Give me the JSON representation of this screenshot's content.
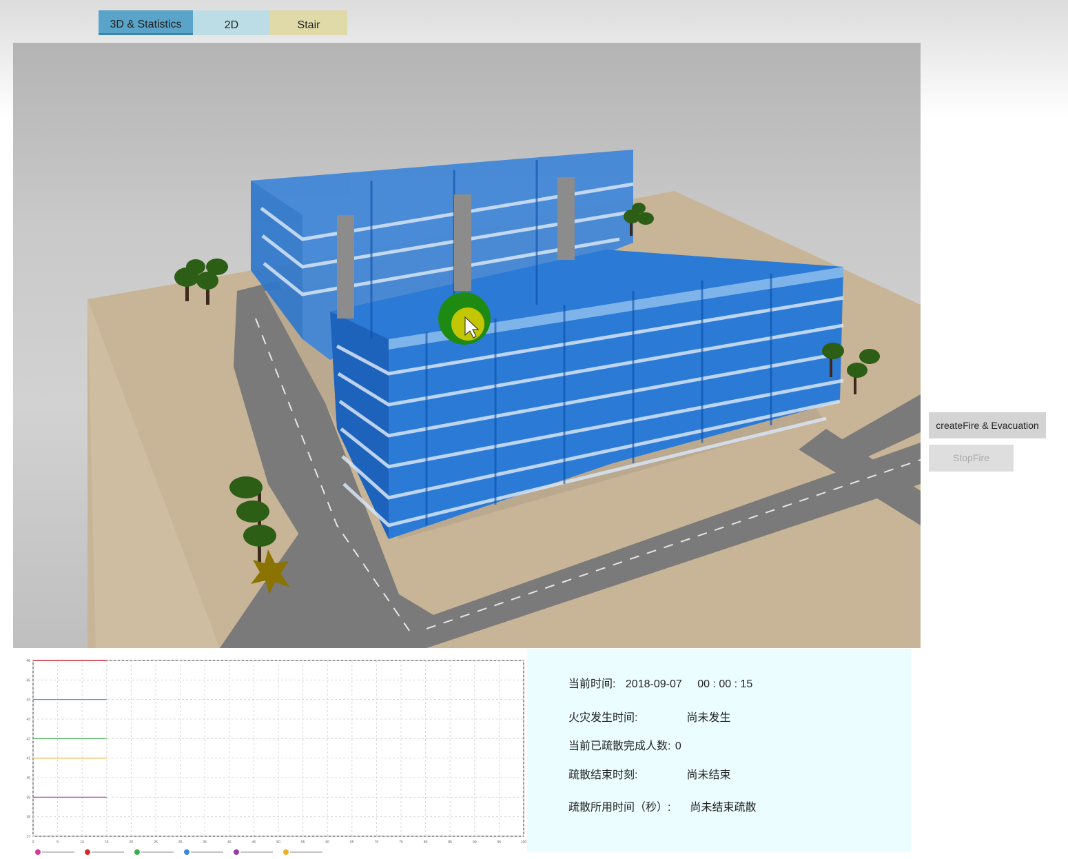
{
  "tabs": [
    {
      "label": "3D & Statistics"
    },
    {
      "label": "2D"
    },
    {
      "label": "Stair"
    }
  ],
  "buttons": {
    "create_fire": "createFire & Evacuation",
    "stop_fire": "StopFire"
  },
  "stats": {
    "current_time_label": "当前时间:",
    "current_date": "2018-09-07",
    "current_time": "00 : 00 : 15",
    "fire_time_label": "火灾发生时间:",
    "fire_time_value": "尚未发生",
    "evacuated_label": "当前已疏散完成人数:",
    "evacuated_value": "0",
    "end_time_label": "疏散结束时刻:",
    "end_time_value": "尚未结束",
    "duration_label": "疏散所用时间（秒）:",
    "duration_value": "尚未结束疏散"
  },
  "colors": {
    "tab_active": "#5aa3c9",
    "tab_2d": "#bcdde5",
    "tab_stair": "#e0d9a8",
    "stats_bg": "#ebfdfe",
    "building_blue": "#1e6fd6"
  },
  "chart_data": {
    "type": "line",
    "x": [
      0,
      5,
      10,
      15
    ],
    "xlim": [
      0,
      100
    ],
    "ylim": [
      37,
      46
    ],
    "x_ticks": [
      0,
      5,
      10,
      15,
      20,
      25,
      30,
      35,
      40,
      45,
      50,
      55,
      60,
      65,
      70,
      75,
      80,
      85,
      90,
      95,
      100
    ],
    "y_ticks": [
      37,
      38,
      39,
      40,
      41,
      42,
      43,
      44,
      45,
      46
    ],
    "grid": true,
    "legend_position": "bottom",
    "series": [
      {
        "color": "#d6389e",
        "values": [
          46,
          46,
          46,
          46
        ]
      },
      {
        "color": "#d62a2a",
        "values": [
          46,
          46,
          46,
          46
        ]
      },
      {
        "color": "#38b24a",
        "values": [
          42,
          42,
          42,
          42
        ]
      },
      {
        "color": "#3b8ad9",
        "values": [
          44,
          44,
          44,
          44
        ]
      },
      {
        "color": "#9b3aa6",
        "values": [
          39,
          39,
          39,
          39
        ]
      },
      {
        "color": "#f0ae24",
        "values": [
          41,
          41,
          41,
          41
        ]
      }
    ]
  }
}
